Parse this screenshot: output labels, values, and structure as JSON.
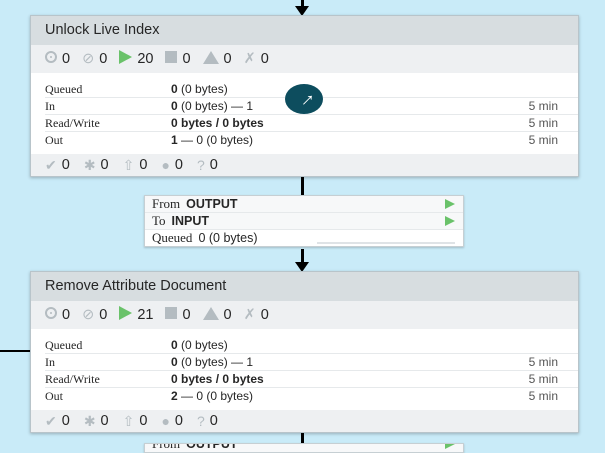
{
  "processors": [
    {
      "name": "Unlock Live Index",
      "status": {
        "running": "0",
        "stopped": "0",
        "invalid_run": "20",
        "disabled": "0",
        "warning": "0",
        "not_transmitting": "0"
      },
      "metrics": [
        {
          "label": "Queued",
          "value": "0",
          "detail": " (0 bytes)",
          "time": ""
        },
        {
          "label": "In",
          "value": "0",
          "detail": " (0 bytes) — 1",
          "time": "5 min"
        },
        {
          "label": "Read/Write",
          "value": "0 bytes / 0 bytes",
          "detail": "",
          "time": "5 min"
        },
        {
          "label": "Out",
          "value": "1",
          "detail": " — 0 (0 bytes)",
          "time": "5 min"
        }
      ],
      "bottom": {
        "up_to_date": "0",
        "modified": "0",
        "stale": "0",
        "errors": "0",
        "unknown": "0"
      }
    },
    {
      "name": "Remove Attribute Document",
      "status": {
        "running": "0",
        "stopped": "0",
        "invalid_run": "21",
        "disabled": "0",
        "warning": "0",
        "not_transmitting": "0"
      },
      "metrics": [
        {
          "label": "Queued",
          "value": "0",
          "detail": " (0 bytes)",
          "time": ""
        },
        {
          "label": "In",
          "value": "0",
          "detail": " (0 bytes) — 1",
          "time": "5 min"
        },
        {
          "label": "Read/Write",
          "value": "0 bytes / 0 bytes",
          "detail": "",
          "time": "5 min"
        },
        {
          "label": "Out",
          "value": "2",
          "detail": " — 0 (0 bytes)",
          "time": "5 min"
        }
      ],
      "bottom": {
        "up_to_date": "0",
        "modified": "0",
        "stale": "0",
        "errors": "0",
        "unknown": "0"
      }
    }
  ],
  "connection": {
    "from_label": "From",
    "from_value": "OUTPUT",
    "to_label": "To",
    "to_value": "INPUT",
    "queued_label": "Queued",
    "queued_value": "0 (0 bytes)"
  },
  "connection2": {
    "from_label": "From",
    "from_value": "OUTPUT"
  },
  "colors": {
    "canvas": "#c9ebf8",
    "header": "#d7dde0",
    "status_row": "#eef0f2",
    "run_green": "#6ac26a",
    "cursor": "#0d4d5e"
  }
}
